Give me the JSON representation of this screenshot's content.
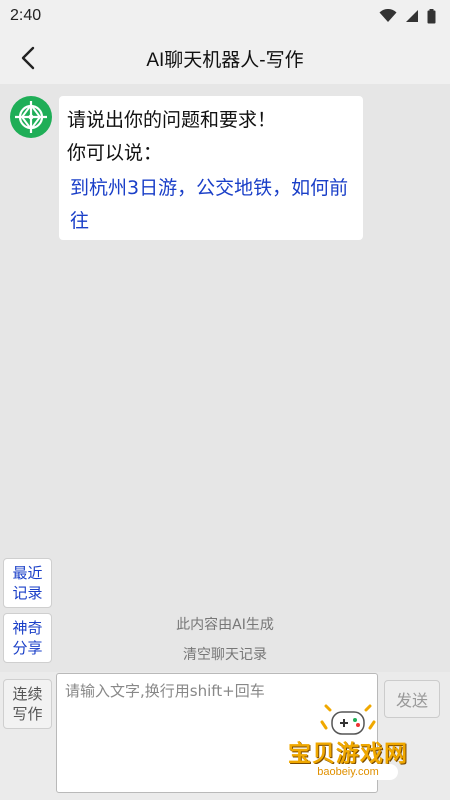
{
  "status_bar": {
    "time": "2:40"
  },
  "header": {
    "title": "AI聊天机器人-写作"
  },
  "chat": {
    "bot_message": {
      "line1": "请说出你的问题和要求！",
      "line2": "你可以说：",
      "suggestion": "到杭州3日游，公交地铁，如何前往"
    }
  },
  "side_buttons": {
    "recent": "最近记录",
    "share": "神奇分享",
    "continuous": "连续写作"
  },
  "footer": {
    "ai_notice": "此内容由AI生成",
    "clear_history": "清空聊天记录"
  },
  "composer": {
    "placeholder": "请输入文字,换行用shift+回车",
    "value": "",
    "send_label": "发送"
  },
  "watermark": {
    "text": "宝贝游戏网",
    "url": "baobeiy.com"
  },
  "colors": {
    "accent_blue": "#1a3fc8",
    "avatar_green": "#1fae57"
  }
}
